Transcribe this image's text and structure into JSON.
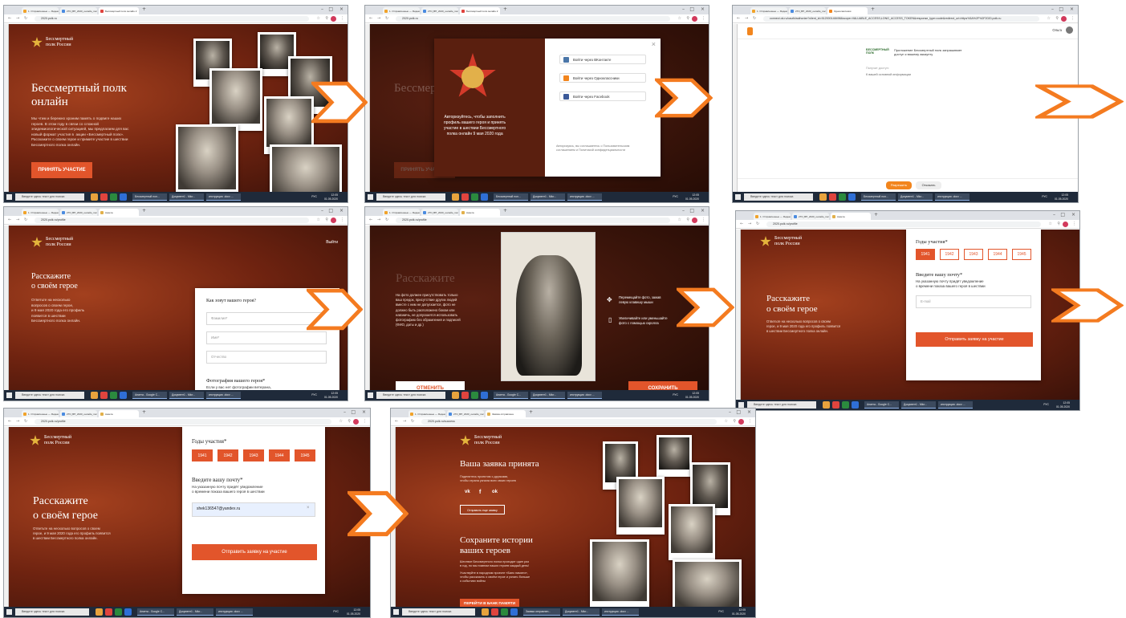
{
  "colors": {
    "accent": "#e2552b",
    "arrow": "#f47b20",
    "page_bg": "#8c2f14"
  },
  "browser": {
    "tab1": "1. Отправленные — Яндекс.П",
    "tab2": "27N_ВП_2020_онлайн_пост.pn",
    "tab_home": "Бессмертный полк онлайн 2",
    "tab_ok": "Одноклассники",
    "tab_anketa": "Анкета",
    "tab_done": "Заявка отправлена",
    "url_home": "2020.polk.ru",
    "url_ok": "connect.ok.ru/oauth/authorize?client_id=512000148498&scope=VALUABLE_ACCESS;LONG_ACCESS_TOKEN&response_type=code&redirect_uri=https%3A%2F%2F2020.polk.ru",
    "url_profile": "2020.polk.ru/profile",
    "url_photo": "2020.polk.ru/profile",
    "url_success": "2020.polk.ru/success"
  },
  "taskbar": {
    "search": "Введите здесь текст для поиска",
    "win_home": "Бессмертный пол...",
    "win_anketa": "Анкета - Google C...",
    "win_done": "Заявка отправлен...",
    "win_doc": "Документ1 - Micr...",
    "win_instr": "инструкция .docx ...",
    "lang": "РУС",
    "time": "12:05",
    "date": "01.05.2020"
  },
  "brand": {
    "logo_text": "Бессмертный\nполк России"
  },
  "s1": {
    "title": "Бессмертный полк\nонлайн",
    "desc": "Мы чтим и бережно храним память о подвиге наших\nгероев. В этом году в связи со сложной\nэпидемиологической ситуацией, мы предлагаем для вас\nновый формат участия в  акции «Бессмертный полк».\nРасскажите о своем герое и примите участие в шествии\nБессмертного полка онлайн.",
    "button": "ПРИНЯТЬ УЧАСТИЕ"
  },
  "s2": {
    "bg_title": "Бессмертный полк онлайн",
    "left_text": "Авторизуйтесь, чтобы заполнить\nпрофиль вашего героя и принять\nучастие в шествии Бессмертного\nполка онлайн 9 мая 2020 года",
    "vk": "Войти через ВКонтакте",
    "ok": "Войти через Одноклассники",
    "fb": "Войти через Facebook",
    "terms": "Авторизуясь, вы соглашаетесь с Пользовательским\nсоглашением и Политикой конфиденциальности",
    "close": "×",
    "bg_button": "ПРИНЯТЬ УЧАСТИЕ"
  },
  "s3": {
    "user": "Ольга",
    "app_logo": "БЕССМЕРТНЫЙ\nПОЛК",
    "request": "Приложение Бессмертный полк запрашивает\nдоступ к вашему аккаунту",
    "access_title": "Получит доступ:",
    "access_item": "К вашей основной информации",
    "allow": "Разрешить",
    "deny": "Отказать"
  },
  "s4": {
    "logout": "Выйти",
    "title": "Расскажите\nо своём герое",
    "desc": "Ответьте на несколько\nвопросов о своем герое,\nи 9 мая 2020 года его профиль\nпоявится в шествии\nБессмертного полка онлайн.",
    "q_name": "Как зовут вашего героя?",
    "f_surname": "Фамилия*",
    "f_name": "Имя*",
    "f_patronymic": "Отчество",
    "photo_title": "Фотография вашего героя*",
    "photo_note": "Если у вас нет фотографии ветерана,\nто оставьте поле под фотографию пустым"
  },
  "s5": {
    "bg_title": "Расскажите",
    "left_text": "На фото должен присутствовать только\nваш предок, присутствие других людей\nвместе с ним не допускается, фото не\nдолжно быть расположено боком или\nнавзничь, не допускается использовать\nфотографию без обрамления и подписей\n(ФИО, даты и др.)",
    "hint_move": "Перемещайте фото, зажав\nлевую клавишу мыши",
    "hint_zoom": "Увеличивайте или уменьшайте\nфото с помощью скролла",
    "cancel": "ОТМЕНИТЬ",
    "save": "СОХРАНИТЬ"
  },
  "s6": {
    "years_title": "Годы участия*",
    "years": [
      "1941",
      "1942",
      "1943",
      "1944",
      "1945"
    ],
    "title": "Расскажите\nо своём герое",
    "desc": "Ответьте на несколько вопросов о своем\nгерое, и 9 мая 2020 года его профиль появится\nв шествии Бессмертного полка онлайн.",
    "email_title": "Введите вашу почту*",
    "email_note": "На указанную почту придёт уведомление\nо времени показа вашего героя в шествии",
    "email_placeholder": "E-mail",
    "submit": "Отправить заявку на участие",
    "hotline": "Горячая линия \"Бессмертного полка\" 8 (800) 30-1945-5"
  },
  "s7": {
    "years_title": "Годы участия*",
    "years": [
      "1941",
      "1942",
      "1943",
      "1944",
      "1945"
    ],
    "title": "Расскажите\nо своём герое",
    "desc": "Ответьте на несколько вопросов о своем\nгерое, и 9 мая 2020 года его профиль появится\nв шествии Бессмертного полка онлайн.",
    "email_title": "Введите вашу почту*",
    "email_note": "На указанную почту придёт уведомление\nо времени показа вашего героя в шествии",
    "email_value": "shek136547@yandex.ru",
    "clear": "×",
    "submit": "Отправить заявку на участие",
    "hotline": "Горячая линия \"Бессмертного полка\" 8 (800) 30-1945-5"
  },
  "s8": {
    "title": "Ваша заявка принята",
    "share": "Поделитесь проектом с друзьями,\nчтобы страна узнала всех своих героев",
    "vk": "vk",
    "fb": "f",
    "ok": "ok",
    "another": "Отправить еще заявку",
    "title2": "Сохраните истории\nваших героев",
    "desc2": "Шествие Бессмертного полка проходит один раз\nв год, но мы помним наших героев каждый день!",
    "desc3": "Участвуйте в народном проекте «Банк памяти»,\nчтобы рассказать о своём герое и узнать больше\nо событиях войны",
    "bank": "ПЕРЕЙТИ В БАНК ПАМЯТИ"
  }
}
